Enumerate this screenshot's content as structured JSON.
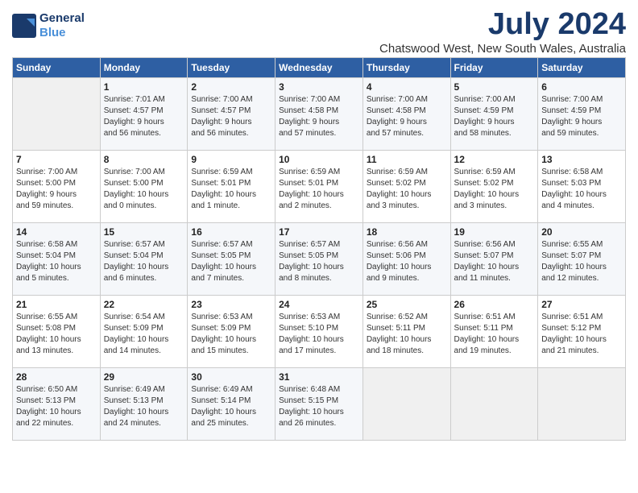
{
  "header": {
    "logo_line1": "General",
    "logo_line2": "Blue",
    "month_title": "July 2024",
    "location": "Chatswood West, New South Wales, Australia"
  },
  "days_of_week": [
    "Sunday",
    "Monday",
    "Tuesday",
    "Wednesday",
    "Thursday",
    "Friday",
    "Saturday"
  ],
  "weeks": [
    [
      {
        "num": "",
        "info": ""
      },
      {
        "num": "1",
        "info": "Sunrise: 7:01 AM\nSunset: 4:57 PM\nDaylight: 9 hours\nand 56 minutes."
      },
      {
        "num": "2",
        "info": "Sunrise: 7:00 AM\nSunset: 4:57 PM\nDaylight: 9 hours\nand 56 minutes."
      },
      {
        "num": "3",
        "info": "Sunrise: 7:00 AM\nSunset: 4:58 PM\nDaylight: 9 hours\nand 57 minutes."
      },
      {
        "num": "4",
        "info": "Sunrise: 7:00 AM\nSunset: 4:58 PM\nDaylight: 9 hours\nand 57 minutes."
      },
      {
        "num": "5",
        "info": "Sunrise: 7:00 AM\nSunset: 4:59 PM\nDaylight: 9 hours\nand 58 minutes."
      },
      {
        "num": "6",
        "info": "Sunrise: 7:00 AM\nSunset: 4:59 PM\nDaylight: 9 hours\nand 59 minutes."
      }
    ],
    [
      {
        "num": "7",
        "info": "Sunrise: 7:00 AM\nSunset: 5:00 PM\nDaylight: 9 hours\nand 59 minutes."
      },
      {
        "num": "8",
        "info": "Sunrise: 7:00 AM\nSunset: 5:00 PM\nDaylight: 10 hours\nand 0 minutes."
      },
      {
        "num": "9",
        "info": "Sunrise: 6:59 AM\nSunset: 5:01 PM\nDaylight: 10 hours\nand 1 minute."
      },
      {
        "num": "10",
        "info": "Sunrise: 6:59 AM\nSunset: 5:01 PM\nDaylight: 10 hours\nand 2 minutes."
      },
      {
        "num": "11",
        "info": "Sunrise: 6:59 AM\nSunset: 5:02 PM\nDaylight: 10 hours\nand 3 minutes."
      },
      {
        "num": "12",
        "info": "Sunrise: 6:59 AM\nSunset: 5:02 PM\nDaylight: 10 hours\nand 3 minutes."
      },
      {
        "num": "13",
        "info": "Sunrise: 6:58 AM\nSunset: 5:03 PM\nDaylight: 10 hours\nand 4 minutes."
      }
    ],
    [
      {
        "num": "14",
        "info": "Sunrise: 6:58 AM\nSunset: 5:04 PM\nDaylight: 10 hours\nand 5 minutes."
      },
      {
        "num": "15",
        "info": "Sunrise: 6:57 AM\nSunset: 5:04 PM\nDaylight: 10 hours\nand 6 minutes."
      },
      {
        "num": "16",
        "info": "Sunrise: 6:57 AM\nSunset: 5:05 PM\nDaylight: 10 hours\nand 7 minutes."
      },
      {
        "num": "17",
        "info": "Sunrise: 6:57 AM\nSunset: 5:05 PM\nDaylight: 10 hours\nand 8 minutes."
      },
      {
        "num": "18",
        "info": "Sunrise: 6:56 AM\nSunset: 5:06 PM\nDaylight: 10 hours\nand 9 minutes."
      },
      {
        "num": "19",
        "info": "Sunrise: 6:56 AM\nSunset: 5:07 PM\nDaylight: 10 hours\nand 11 minutes."
      },
      {
        "num": "20",
        "info": "Sunrise: 6:55 AM\nSunset: 5:07 PM\nDaylight: 10 hours\nand 12 minutes."
      }
    ],
    [
      {
        "num": "21",
        "info": "Sunrise: 6:55 AM\nSunset: 5:08 PM\nDaylight: 10 hours\nand 13 minutes."
      },
      {
        "num": "22",
        "info": "Sunrise: 6:54 AM\nSunset: 5:09 PM\nDaylight: 10 hours\nand 14 minutes."
      },
      {
        "num": "23",
        "info": "Sunrise: 6:53 AM\nSunset: 5:09 PM\nDaylight: 10 hours\nand 15 minutes."
      },
      {
        "num": "24",
        "info": "Sunrise: 6:53 AM\nSunset: 5:10 PM\nDaylight: 10 hours\nand 17 minutes."
      },
      {
        "num": "25",
        "info": "Sunrise: 6:52 AM\nSunset: 5:11 PM\nDaylight: 10 hours\nand 18 minutes."
      },
      {
        "num": "26",
        "info": "Sunrise: 6:51 AM\nSunset: 5:11 PM\nDaylight: 10 hours\nand 19 minutes."
      },
      {
        "num": "27",
        "info": "Sunrise: 6:51 AM\nSunset: 5:12 PM\nDaylight: 10 hours\nand 21 minutes."
      }
    ],
    [
      {
        "num": "28",
        "info": "Sunrise: 6:50 AM\nSunset: 5:13 PM\nDaylight: 10 hours\nand 22 minutes."
      },
      {
        "num": "29",
        "info": "Sunrise: 6:49 AM\nSunset: 5:13 PM\nDaylight: 10 hours\nand 24 minutes."
      },
      {
        "num": "30",
        "info": "Sunrise: 6:49 AM\nSunset: 5:14 PM\nDaylight: 10 hours\nand 25 minutes."
      },
      {
        "num": "31",
        "info": "Sunrise: 6:48 AM\nSunset: 5:15 PM\nDaylight: 10 hours\nand 26 minutes."
      },
      {
        "num": "",
        "info": ""
      },
      {
        "num": "",
        "info": ""
      },
      {
        "num": "",
        "info": ""
      }
    ]
  ]
}
